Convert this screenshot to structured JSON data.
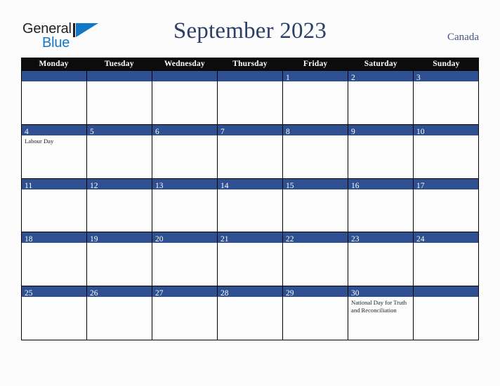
{
  "brand": {
    "name_part1": "General",
    "name_part2": "Blue",
    "mark": "triangle-logo",
    "color_dark": "#231f20",
    "color_blue": "#1277c4"
  },
  "header": {
    "title": "September 2023",
    "region": "Canada",
    "title_color": "#2c3f66"
  },
  "calendar": {
    "accent_color": "#2e5090",
    "header_bg": "#0c0c0c",
    "day_names": [
      "Monday",
      "Tuesday",
      "Wednesday",
      "Thursday",
      "Friday",
      "Saturday",
      "Sunday"
    ],
    "weeks": [
      [
        {
          "day": "",
          "event": ""
        },
        {
          "day": "",
          "event": ""
        },
        {
          "day": "",
          "event": ""
        },
        {
          "day": "",
          "event": ""
        },
        {
          "day": "1",
          "event": ""
        },
        {
          "day": "2",
          "event": ""
        },
        {
          "day": "3",
          "event": ""
        }
      ],
      [
        {
          "day": "4",
          "event": "Labour Day"
        },
        {
          "day": "5",
          "event": ""
        },
        {
          "day": "6",
          "event": ""
        },
        {
          "day": "7",
          "event": ""
        },
        {
          "day": "8",
          "event": ""
        },
        {
          "day": "9",
          "event": ""
        },
        {
          "day": "10",
          "event": ""
        }
      ],
      [
        {
          "day": "11",
          "event": ""
        },
        {
          "day": "12",
          "event": ""
        },
        {
          "day": "13",
          "event": ""
        },
        {
          "day": "14",
          "event": ""
        },
        {
          "day": "15",
          "event": ""
        },
        {
          "day": "16",
          "event": ""
        },
        {
          "day": "17",
          "event": ""
        }
      ],
      [
        {
          "day": "18",
          "event": ""
        },
        {
          "day": "19",
          "event": ""
        },
        {
          "day": "20",
          "event": ""
        },
        {
          "day": "21",
          "event": ""
        },
        {
          "day": "22",
          "event": ""
        },
        {
          "day": "23",
          "event": ""
        },
        {
          "day": "24",
          "event": ""
        }
      ],
      [
        {
          "day": "25",
          "event": ""
        },
        {
          "day": "26",
          "event": ""
        },
        {
          "day": "27",
          "event": ""
        },
        {
          "day": "28",
          "event": ""
        },
        {
          "day": "29",
          "event": ""
        },
        {
          "day": "30",
          "event": "National Day for Truth and Reconciliation"
        },
        {
          "day": "",
          "event": ""
        }
      ]
    ]
  }
}
